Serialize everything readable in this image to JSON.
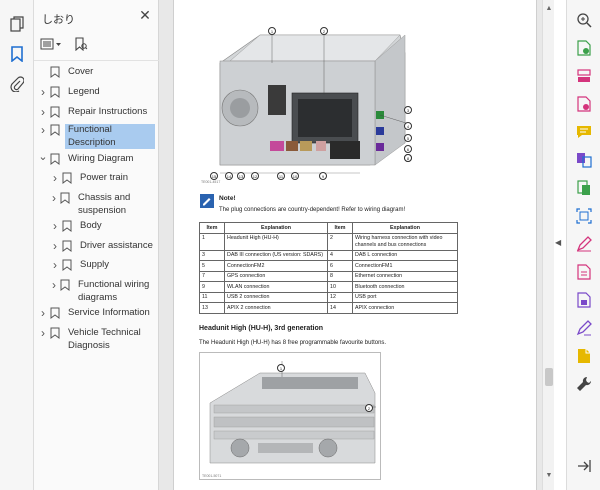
{
  "left_toolbar": {
    "icons": [
      "pages-icon",
      "bookmark-icon",
      "attachment-icon"
    ]
  },
  "bookmarks_panel": {
    "title": "しおり",
    "items": [
      {
        "label": "Cover",
        "level": 0,
        "expandable": false
      },
      {
        "label": "Legend",
        "level": 0,
        "expandable": true
      },
      {
        "label": "Repair Instructions",
        "level": 0,
        "expandable": true
      },
      {
        "label": "Functional Description",
        "level": 0,
        "expandable": true,
        "selected": true
      },
      {
        "label": "Wiring Diagram",
        "level": 0,
        "expandable": true,
        "expanded": true
      },
      {
        "label": "Power train",
        "level": 1,
        "expandable": true
      },
      {
        "label": "Chassis and suspension",
        "level": 1,
        "expandable": true
      },
      {
        "label": "Body",
        "level": 1,
        "expandable": true
      },
      {
        "label": "Driver assistance",
        "level": 1,
        "expandable": true
      },
      {
        "label": "Supply",
        "level": 1,
        "expandable": true
      },
      {
        "label": "Functional wiring diagrams",
        "level": 1,
        "expandable": true
      },
      {
        "label": "Service Information",
        "level": 0,
        "expandable": true
      },
      {
        "label": "Vehicle Technical Diagnosis",
        "level": 0,
        "expandable": true
      }
    ]
  },
  "document": {
    "figure1": {
      "caption": "TE001-4517",
      "callouts_top": [
        "1",
        "2"
      ],
      "callouts_right": [
        "3",
        "4",
        "5",
        "6",
        "7",
        "8"
      ],
      "callouts_bottom": [
        "15",
        "14",
        "13",
        "12",
        "11",
        "10",
        "9"
      ]
    },
    "note": {
      "title": "Note!",
      "text": "The plug connections are country-dependent! Refer to wiring diagram!"
    },
    "table": {
      "headers": [
        "Item",
        "Explanation",
        "Item",
        "Explanation"
      ],
      "rows": [
        [
          "1",
          "Headunit High (HU-H)",
          "2",
          "Wiring harness connection with video channels and bus connections"
        ],
        [
          "3",
          "DAB III connection (US version: SDARS)",
          "4",
          "DAB L connection"
        ],
        [
          "5",
          "ConnectionFM2",
          "6",
          "ConnectionFM1"
        ],
        [
          "7",
          "GPS connection",
          "8",
          "Ethernet connection"
        ],
        [
          "9",
          "WLAN connection",
          "10",
          "Bluetooth connection"
        ],
        [
          "11",
          "USB 2 connection",
          "12",
          "USB port"
        ],
        [
          "13",
          "APIX 2 connection",
          "14",
          "APIX connection"
        ]
      ]
    },
    "heading": "Headunit High (HU-H), 3rd generation",
    "paragraph": "The Headunit High (HU-H) has 8 free programmable favourite buttons.",
    "figure2": {
      "caption": "TE001-5071",
      "callouts": [
        "1",
        "2"
      ]
    }
  },
  "right_toolbar": {
    "icons": [
      "search-zoom-icon",
      "export-pdf-icon",
      "organize-pages-icon",
      "create-pdf-icon",
      "comment-icon",
      "combine-files-icon",
      "compress-icon",
      "scan-icon",
      "edit-pdf-icon",
      "convert-icon",
      "protect-icon",
      "fill-sign-icon",
      "more-tools-icon",
      "wrench-icon",
      "expand-panel-icon"
    ]
  },
  "colors": {
    "selection": "#a9cbef",
    "accent_blue": "#1f6fd1",
    "tool_pink": "#d4347c",
    "tool_yellow": "#e6b800",
    "tool_green": "#3ba04a",
    "tool_purple": "#7a49c9"
  }
}
